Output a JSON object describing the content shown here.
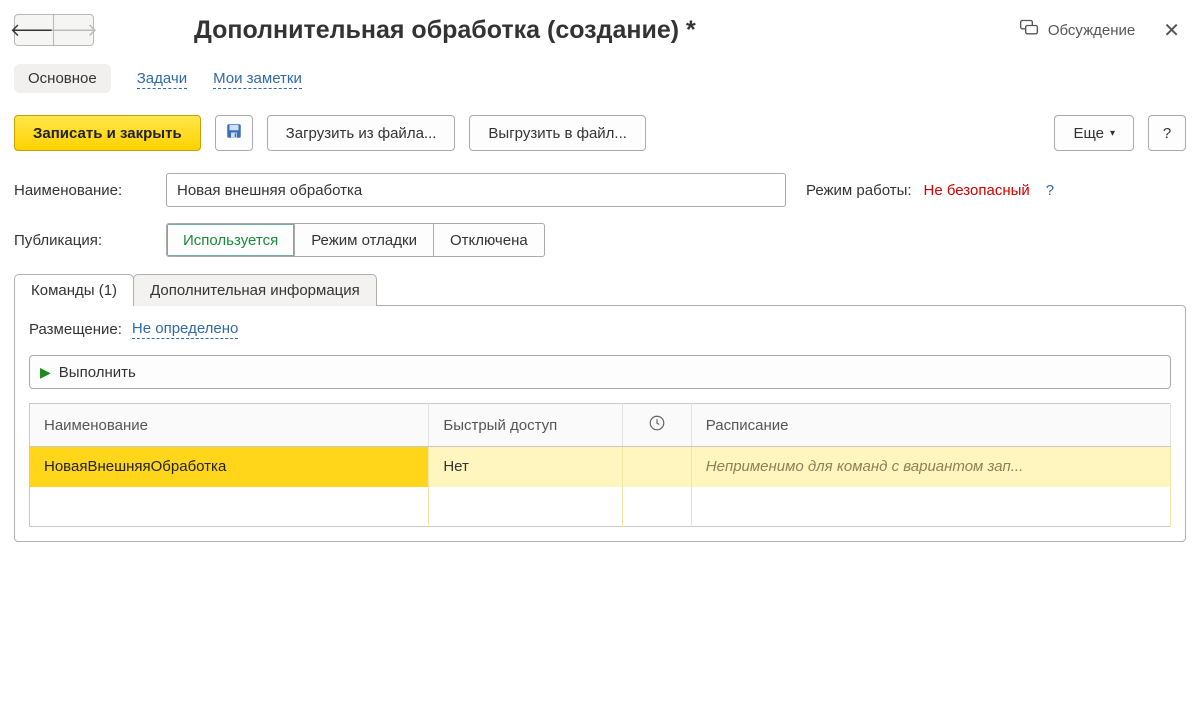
{
  "header": {
    "title": "Дополнительная обработка (создание) *",
    "discuss": "Обсуждение"
  },
  "nav": {
    "main": "Основное",
    "tasks": "Задачи",
    "notes": "Мои заметки"
  },
  "toolbar": {
    "save_close": "Записать и закрыть",
    "load_file": "Загрузить из файла...",
    "export_file": "Выгрузить в файл...",
    "more": "Еще",
    "help": "?"
  },
  "form": {
    "name_label": "Наименование:",
    "name_value": "Новая внешняя обработка",
    "mode_label": "Режим работы:",
    "mode_value": "Не безопасный",
    "mode_help": "?",
    "pub_label": "Публикация:",
    "pub_opts": {
      "used": "Используется",
      "debug": "Режим отладки",
      "off": "Отключена"
    }
  },
  "subtabs": {
    "commands": "Команды (1)",
    "addinfo": "Дополнительная информация"
  },
  "panel": {
    "place_label": "Размещение:",
    "place_value": "Не определено",
    "run": "Выполнить",
    "cols": {
      "name": "Наименование",
      "quick": "Быстрый доступ",
      "sched": "Расписание"
    },
    "row": {
      "name": "НоваяВнешняяОбработка",
      "quick": "Нет",
      "sched": "Неприменимо для команд с вариантом зап..."
    }
  }
}
